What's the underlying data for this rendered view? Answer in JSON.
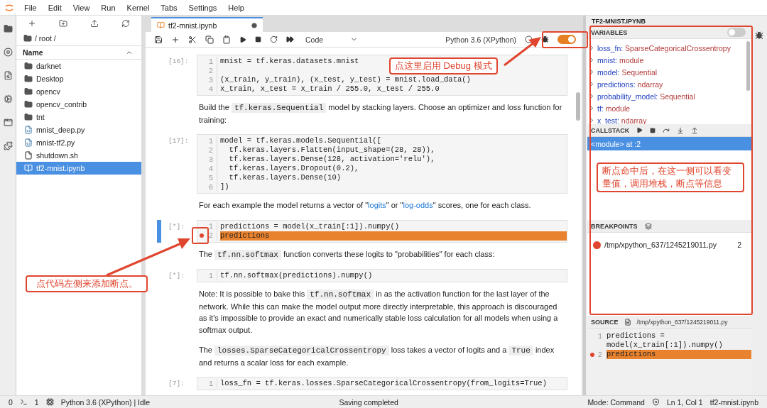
{
  "menu": [
    "File",
    "Edit",
    "View",
    "Run",
    "Kernel",
    "Tabs",
    "Settings",
    "Help"
  ],
  "file_browser": {
    "path": "/ root /",
    "column": "Name",
    "items": [
      {
        "name": "darknet",
        "kind": "folder",
        "selected": false
      },
      {
        "name": "Desktop",
        "kind": "folder",
        "selected": false
      },
      {
        "name": "opencv",
        "kind": "folder",
        "selected": false
      },
      {
        "name": "opencv_contrib",
        "kind": "folder",
        "selected": false
      },
      {
        "name": "tnt",
        "kind": "folder",
        "selected": false
      },
      {
        "name": "mnist_deep.py",
        "kind": "python",
        "selected": false
      },
      {
        "name": "mnist-tf2.py",
        "kind": "python",
        "selected": false
      },
      {
        "name": "shutdown.sh",
        "kind": "file",
        "selected": false
      },
      {
        "name": "tf2-mnist.ipynb",
        "kind": "notebook",
        "selected": true
      }
    ]
  },
  "notebook_tab": {
    "title": "tf2-mnist.ipynb",
    "modified": true
  },
  "toolbar": {
    "cell_type": "Code",
    "kernel": "Python 3.6 (XPython)",
    "debug_on": true
  },
  "cells": [
    {
      "kind": "code",
      "prompt": "[16]:",
      "active": false,
      "lines": [
        {
          "n": "1",
          "code": "mnist = tf.keras.datasets.mnist",
          "breakpoint": false,
          "highlighted": false
        },
        {
          "n": "2",
          "breakpoint": false,
          "highlighted": false
        },
        {
          "n": "3",
          "code": "(x_train, y_train), (x_test, y_test) = mnist.load_data()",
          "breakpoint": false,
          "highlighted": false
        },
        {
          "n": "4",
          "code": "x_train, x_test = x_train / 255.0, x_test / 255.0",
          "breakpoint": false,
          "highlighted": false
        }
      ]
    },
    {
      "kind": "markdown",
      "parts": [
        {
          "kind": "plain",
          "text": "Build the "
        },
        {
          "kind": "code",
          "text": "tf.keras.Sequential"
        },
        {
          "kind": "plain",
          "text": " model by stacking layers. Choose an optimizer and loss function for training:"
        }
      ]
    },
    {
      "kind": "code",
      "prompt": "[17]:",
      "active": false,
      "lines": [
        {
          "n": "1",
          "code": "model = tf.keras.models.Sequential([",
          "breakpoint": false,
          "highlighted": false
        },
        {
          "n": "2",
          "code": "  tf.keras.layers.Flatten(input_shape=(28, 28)),",
          "breakpoint": false,
          "highlighted": false
        },
        {
          "n": "3",
          "code": "  tf.keras.layers.Dense(128, activation='relu'),",
          "breakpoint": false,
          "highlighted": false
        },
        {
          "n": "4",
          "code": "  tf.keras.layers.Dropout(0.2),",
          "breakpoint": false,
          "highlighted": false
        },
        {
          "n": "5",
          "code": "  tf.keras.layers.Dense(10)",
          "breakpoint": false,
          "highlighted": false
        },
        {
          "n": "6",
          "code": "])",
          "breakpoint": false,
          "highlighted": false
        }
      ]
    },
    {
      "kind": "markdown",
      "parts": [
        {
          "kind": "plain",
          "text": "For each example the model returns a vector of \""
        },
        {
          "kind": "link",
          "text": "logits"
        },
        {
          "kind": "plain",
          "text": "\" or \""
        },
        {
          "kind": "link",
          "text": "log-odds"
        },
        {
          "kind": "plain",
          "text": "\" scores, one for each class."
        }
      ]
    },
    {
      "kind": "code",
      "prompt": "[*]:",
      "active": true,
      "lines": [
        {
          "n": "1",
          "code": "predictions = model(x_train[:1]).numpy()",
          "breakpoint": false,
          "highlighted": false
        },
        {
          "n": "2",
          "code": "predictions",
          "breakpoint": true,
          "highlighted": true
        }
      ]
    },
    {
      "kind": "markdown",
      "parts": [
        {
          "kind": "plain",
          "text": "The "
        },
        {
          "kind": "code",
          "text": "tf.nn.softmax"
        },
        {
          "kind": "plain",
          "text": " function converts these logits to \"probabilities\" for each class:"
        }
      ]
    },
    {
      "kind": "code",
      "prompt": "[*]:",
      "active": false,
      "lines": [
        {
          "n": "1",
          "code": "tf.nn.softmax(predictions).numpy()",
          "breakpoint": false,
          "highlighted": false
        }
      ]
    },
    {
      "kind": "markdown",
      "parts": [
        {
          "kind": "plain",
          "text": "Note: It is possible to bake this "
        },
        {
          "kind": "code",
          "text": "tf.nn.softmax"
        },
        {
          "kind": "plain",
          "text": " in as the activation function for the last layer of the network. While this can make the model output more directly interpretable, this approach is discouraged as it's impossible to provide an exact and numerically stable loss calculation for all models when using a softmax output."
        }
      ]
    },
    {
      "kind": "markdown",
      "parts": [
        {
          "kind": "plain",
          "text": "The "
        },
        {
          "kind": "code",
          "text": "losses.SparseCategoricalCrossentropy"
        },
        {
          "kind": "plain",
          "text": " loss takes a vector of logits and a "
        },
        {
          "kind": "code",
          "text": "True"
        },
        {
          "kind": "plain",
          "text": " index and returns a scalar loss for each example."
        }
      ]
    },
    {
      "kind": "code",
      "prompt": "[7]:",
      "active": false,
      "lines": [
        {
          "n": "1",
          "code": "loss_fn = tf.keras.losses.SparseCategoricalCrossentropy(from_logits=True)",
          "breakpoint": false,
          "highlighted": false
        }
      ]
    }
  ],
  "debugger": {
    "title": "TF2-MNIST.IPYNB",
    "variables": {
      "header": "VARIABLES",
      "filter_on": false,
      "items": [
        {
          "name": "loss_fn:",
          "type": "SparseCategoricalCrossentropy"
        },
        {
          "name": "mnist:",
          "type": "module"
        },
        {
          "name": "model:",
          "type": "Sequential"
        },
        {
          "name": "predictions:",
          "type": "ndarray"
        },
        {
          "name": "probability_model:",
          "type": "Sequential"
        },
        {
          "name": "tf:",
          "type": "module"
        },
        {
          "name": "x_test:",
          "type": "ndarray"
        }
      ]
    },
    "callstack": {
      "header": "CALLSTACK",
      "frames": [
        {
          "text": "<module> at :2",
          "selected": true
        }
      ]
    },
    "breakpoints": {
      "header": "BREAKPOINTS",
      "items": [
        {
          "path": "/tmp/xpython_637/1245219011.py",
          "line": "2"
        }
      ]
    },
    "source": {
      "header": "SOURCE",
      "path": "/tmp/xpython_637/1245219011.py",
      "lines": [
        {
          "n": "1",
          "code": "predictions = model(x_train[:1]).numpy()",
          "breakpoint": false,
          "highlighted": false
        },
        {
          "n": "2",
          "code": "predictions",
          "breakpoint": true,
          "highlighted": true
        }
      ]
    }
  },
  "status_bar": {
    "count": "0",
    "terminals": "1",
    "kernel_status": "Python 3.6 (XPython) | Idle",
    "message": "Saving completed",
    "mode": "Mode: Command",
    "position": "Ln 1, Col 1",
    "file": "tf2-mnist.ipynb"
  },
  "annotations": [
    {
      "kind": "debug_toggle_hint",
      "text": "点这里启用 Debug 模式"
    },
    {
      "kind": "debugger_panel_hint",
      "text": "断点命中后，在这一侧可以看变量值，调用堆栈，断点等信息"
    },
    {
      "kind": "breakpoint_hint",
      "text": "点代码左侧来添加断点。"
    }
  ]
}
